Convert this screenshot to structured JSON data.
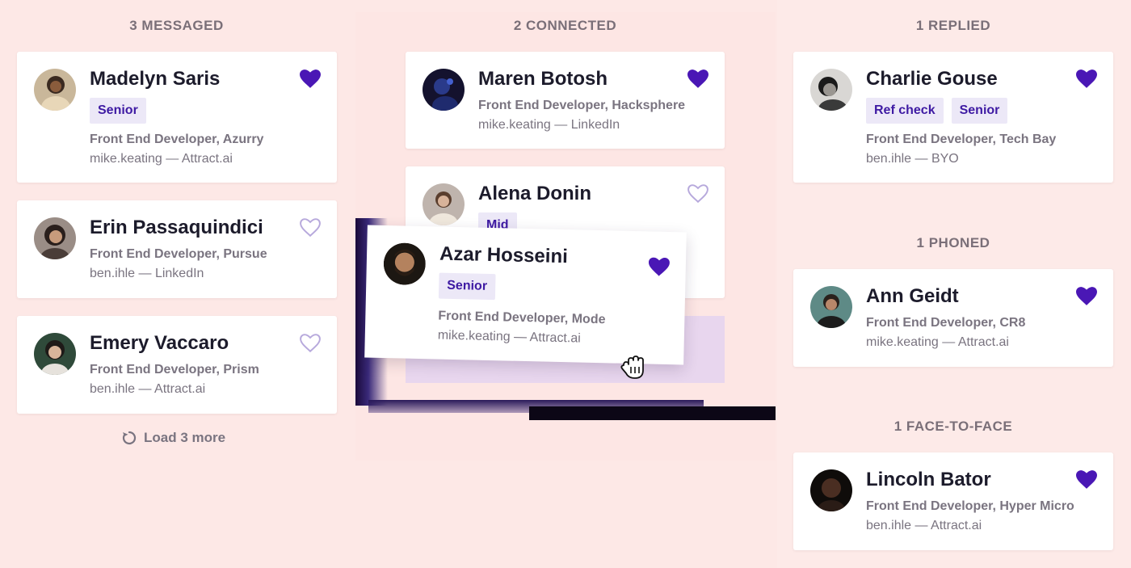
{
  "columns": [
    {
      "title": "3 MESSAGED",
      "load_more": "Load 3 more",
      "cards": [
        {
          "name": "Madelyn Saris",
          "tags": [
            "Senior"
          ],
          "role": "Front End Developer, Azurry",
          "source": "mike.keating — Attract.ai",
          "liked": true
        },
        {
          "name": "Erin Passaquindici",
          "tags": [],
          "role": "Front End Developer, Pursue",
          "source": "ben.ihle — LinkedIn",
          "liked": false
        },
        {
          "name": "Emery Vaccaro",
          "tags": [],
          "role": "Front End Developer, Prism",
          "source": "ben.ihle — Attract.ai",
          "liked": false
        }
      ]
    },
    {
      "title": "2 CONNECTED",
      "cards": [
        {
          "name": "Maren Botosh",
          "tags": [],
          "role": "Front End Developer, Hacksphere",
          "source": "mike.keating — LinkedIn",
          "liked": true
        },
        {
          "name": "Alena Donin",
          "tags": [
            "Mid"
          ],
          "liked": false
        }
      ]
    },
    {
      "title": "1 REPLIED",
      "cards": [
        {
          "name": "Charlie Gouse",
          "tags": [
            "Ref check",
            "Senior"
          ],
          "role": "Front End Developer, Tech Bay",
          "source": "ben.ihle — BYO",
          "liked": true
        }
      ]
    },
    {
      "title": "1 PHONED",
      "cards": [
        {
          "name": "Ann Geidt",
          "tags": [],
          "role": "Front End Developer, CR8",
          "source": "mike.keating — Attract.ai",
          "liked": true
        }
      ]
    },
    {
      "title": "1 FACE-TO-FACE",
      "cards": [
        {
          "name": "Lincoln Bator",
          "tags": [],
          "role": "Front End Developer, Hyper Micro",
          "source": "ben.ihle — Attract.ai",
          "liked": true
        }
      ]
    }
  ],
  "dragging": {
    "name": "Azar Hosseini",
    "tags": [
      "Senior"
    ],
    "role": "Front End Developer, Mode",
    "source": "mike.keating — Attract.ai",
    "liked": true
  },
  "colors": {
    "accent": "#4a17b5",
    "tag_bg": "#ece8f7",
    "tag_text": "#3e1aa3",
    "background": "#fde8e6",
    "muted_text": "#7a7480"
  },
  "icons": {
    "liked": "heart-filled-icon",
    "not_liked": "heart-outline-icon",
    "load_more": "refresh-icon",
    "cursor": "grab-hand-icon"
  }
}
